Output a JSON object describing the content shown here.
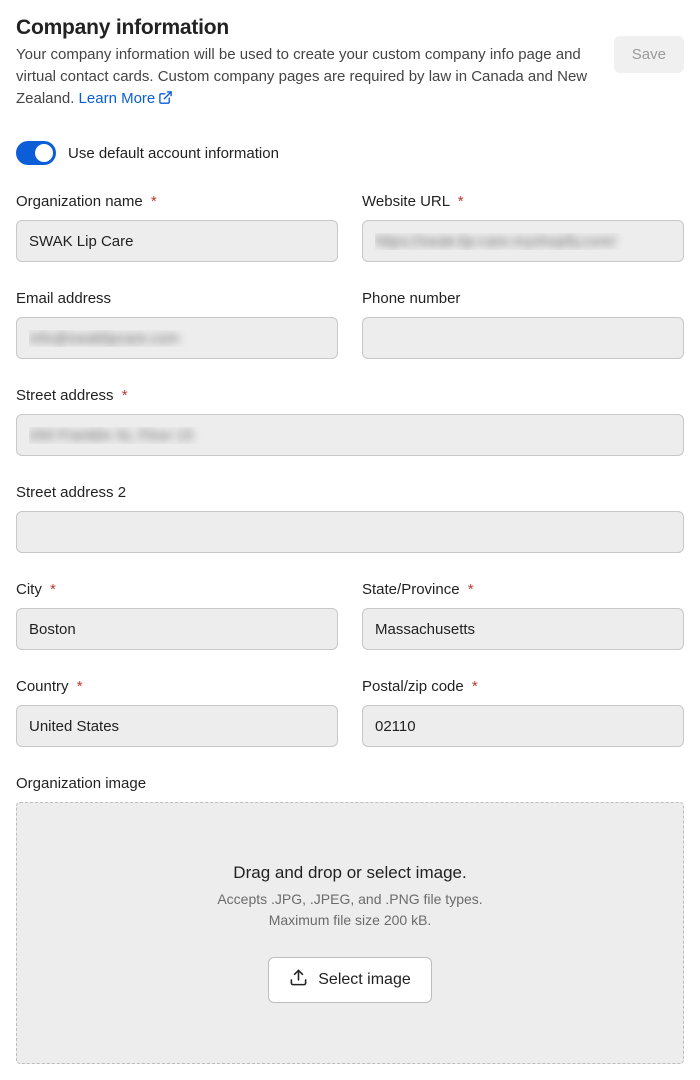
{
  "header": {
    "title": "Company information",
    "subtitle": "Your company information will be used to create your custom company info page and virtual contact cards. Custom company pages are required by law in Canada and New Zealand. ",
    "learn_more": "Learn More",
    "save_label": "Save"
  },
  "toggle": {
    "label": "Use default account information",
    "on": true
  },
  "fields": {
    "org_name": {
      "label": "Organization name",
      "required": true,
      "value": "SWAK Lip Care"
    },
    "website": {
      "label": "Website URL",
      "required": true,
      "value": "https://swak-lip-care.myshopify.com/"
    },
    "email": {
      "label": "Email address",
      "required": false,
      "value": "info@swaklipcare.com"
    },
    "phone": {
      "label": "Phone number",
      "required": false,
      "value": ""
    },
    "street1": {
      "label": "Street address",
      "required": true,
      "value": "200 Franklin St, Floor 15"
    },
    "street2": {
      "label": "Street address 2",
      "required": false,
      "value": ""
    },
    "city": {
      "label": "City",
      "required": true,
      "value": "Boston"
    },
    "state": {
      "label": "State/Province",
      "required": true,
      "value": "Massachusetts"
    },
    "country": {
      "label": "Country",
      "required": true,
      "value": "United States"
    },
    "postal": {
      "label": "Postal/zip code",
      "required": true,
      "value": "02110"
    }
  },
  "org_image": {
    "label": "Organization image",
    "drop_title": "Drag and drop or select image.",
    "accepts": "Accepts .JPG, .JPEG, and .PNG file types.",
    "max_size": "Maximum file size 200 kB.",
    "select_label": "Select image"
  },
  "required_marker": "*"
}
